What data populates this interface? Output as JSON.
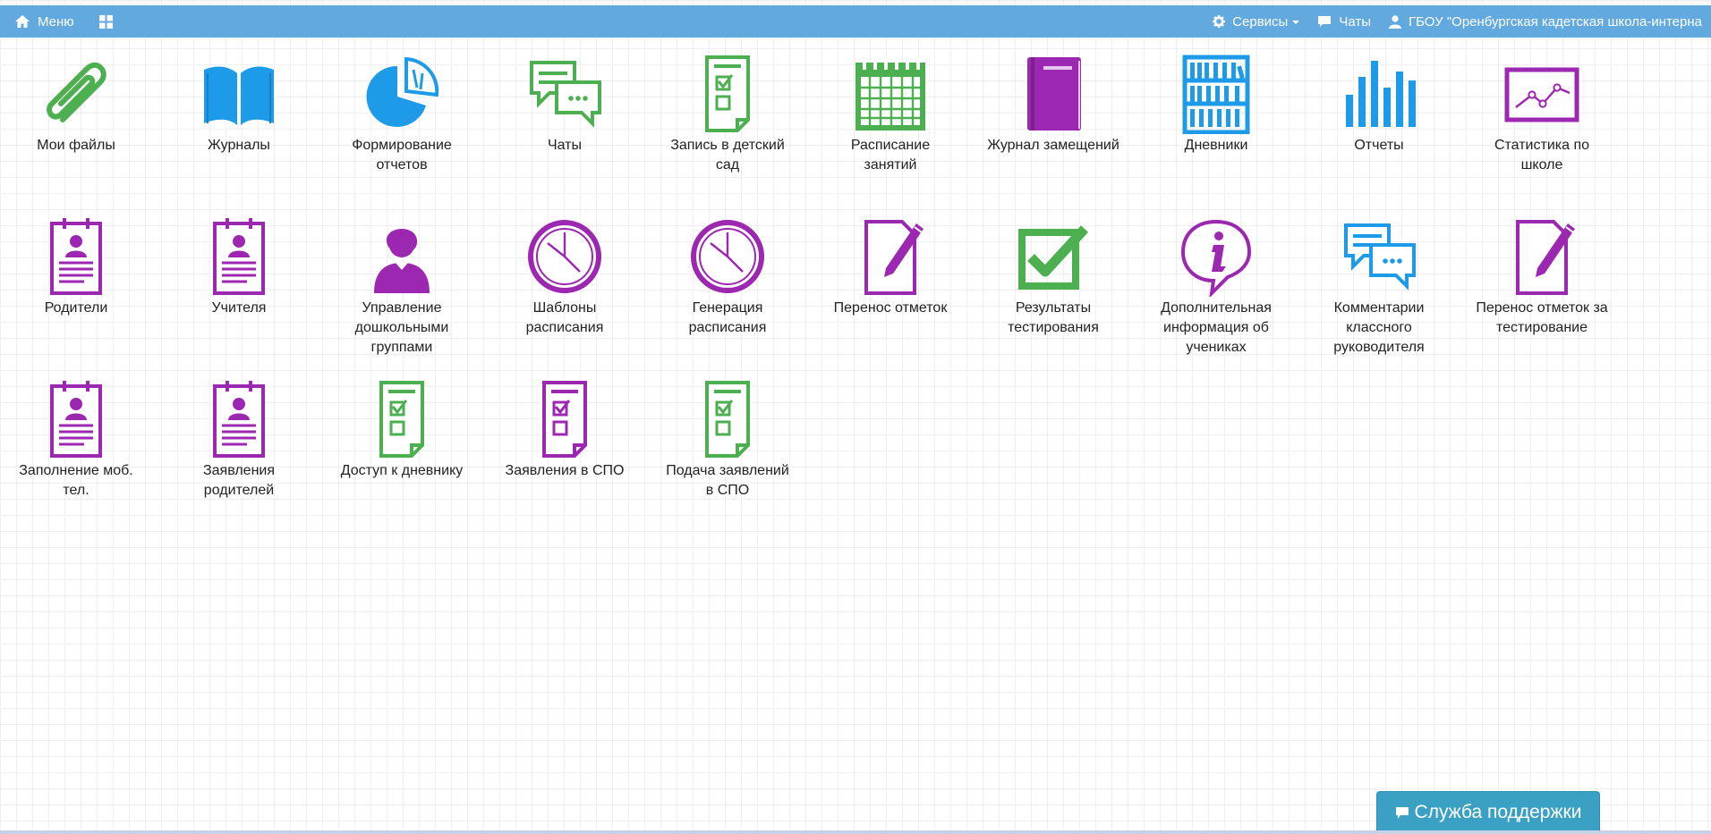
{
  "header": {
    "menu_label": "Меню",
    "services_label": "Сервисы",
    "chats_label": "Чаты",
    "user_label": "ГБОУ \"Оренбургская кадетская школа-интерна"
  },
  "colors": {
    "header_bg": "#62a9e0",
    "green": "#4caf50",
    "blue": "#1e9be8",
    "purple": "#9c27b0",
    "support_bg": "#3aa1c4"
  },
  "tiles": [
    {
      "label": "Мои файлы",
      "icon": "paperclip-icon"
    },
    {
      "label": "Журналы",
      "icon": "book-icon"
    },
    {
      "label": "Формирование отчетов",
      "icon": "pie-chart-icon"
    },
    {
      "label": "Чаты",
      "icon": "chat-icon"
    },
    {
      "label": "Запись в детский сад",
      "icon": "checklist-icon"
    },
    {
      "label": "Расписание занятий",
      "icon": "calendar-icon"
    },
    {
      "label": "Журнал замещений",
      "icon": "journal-icon"
    },
    {
      "label": "Дневники",
      "icon": "bookshelf-icon"
    },
    {
      "label": "Отчеты",
      "icon": "bar-chart-icon"
    },
    {
      "label": "Статистика по школе",
      "icon": "line-chart-icon"
    },
    {
      "label": "Родители",
      "icon": "person-card-icon"
    },
    {
      "label": "Учителя",
      "icon": "person-card-icon"
    },
    {
      "label": "Управление дошкольными группами",
      "icon": "user-icon"
    },
    {
      "label": "Шаблоны расписания",
      "icon": "clock-icon"
    },
    {
      "label": "Генерация расписания",
      "icon": "clock-icon"
    },
    {
      "label": "Перенос отметок",
      "icon": "edit-document-icon"
    },
    {
      "label": "Результаты тестирования",
      "icon": "check-box-icon"
    },
    {
      "label": "Дополнительная информация об учениках",
      "icon": "info-bubble-icon"
    },
    {
      "label": "Комментарии классного руководителя",
      "icon": "chat-icon"
    },
    {
      "label": "Перенос отметок за тестирование",
      "icon": "edit-document-icon"
    },
    {
      "label": "Заполнение моб. тел.",
      "icon": "person-card-icon"
    },
    {
      "label": "Заявления родителей",
      "icon": "person-card-icon"
    },
    {
      "label": "Доступ к дневнику",
      "icon": "checklist-icon"
    },
    {
      "label": "Заявления в СПО",
      "icon": "checklist-icon"
    },
    {
      "label": "Подача заявлений в СПО",
      "icon": "checklist-icon"
    }
  ],
  "support": {
    "label": "Служба поддержки"
  }
}
